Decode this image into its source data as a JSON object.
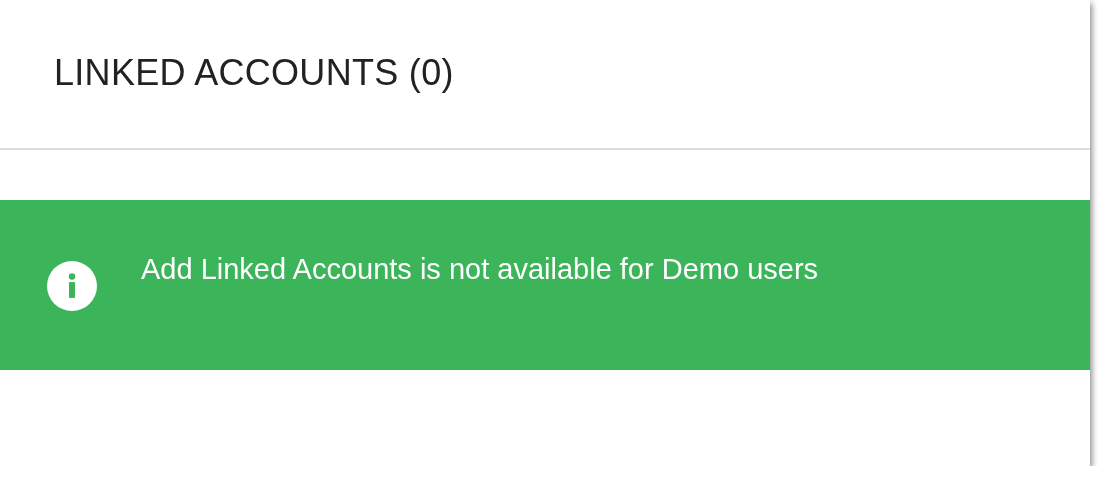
{
  "card": {
    "title": "LINKED ACCOUNTS (0)"
  },
  "alert": {
    "kind": "info",
    "message": "Add Linked Accounts is not available for Demo users"
  }
}
